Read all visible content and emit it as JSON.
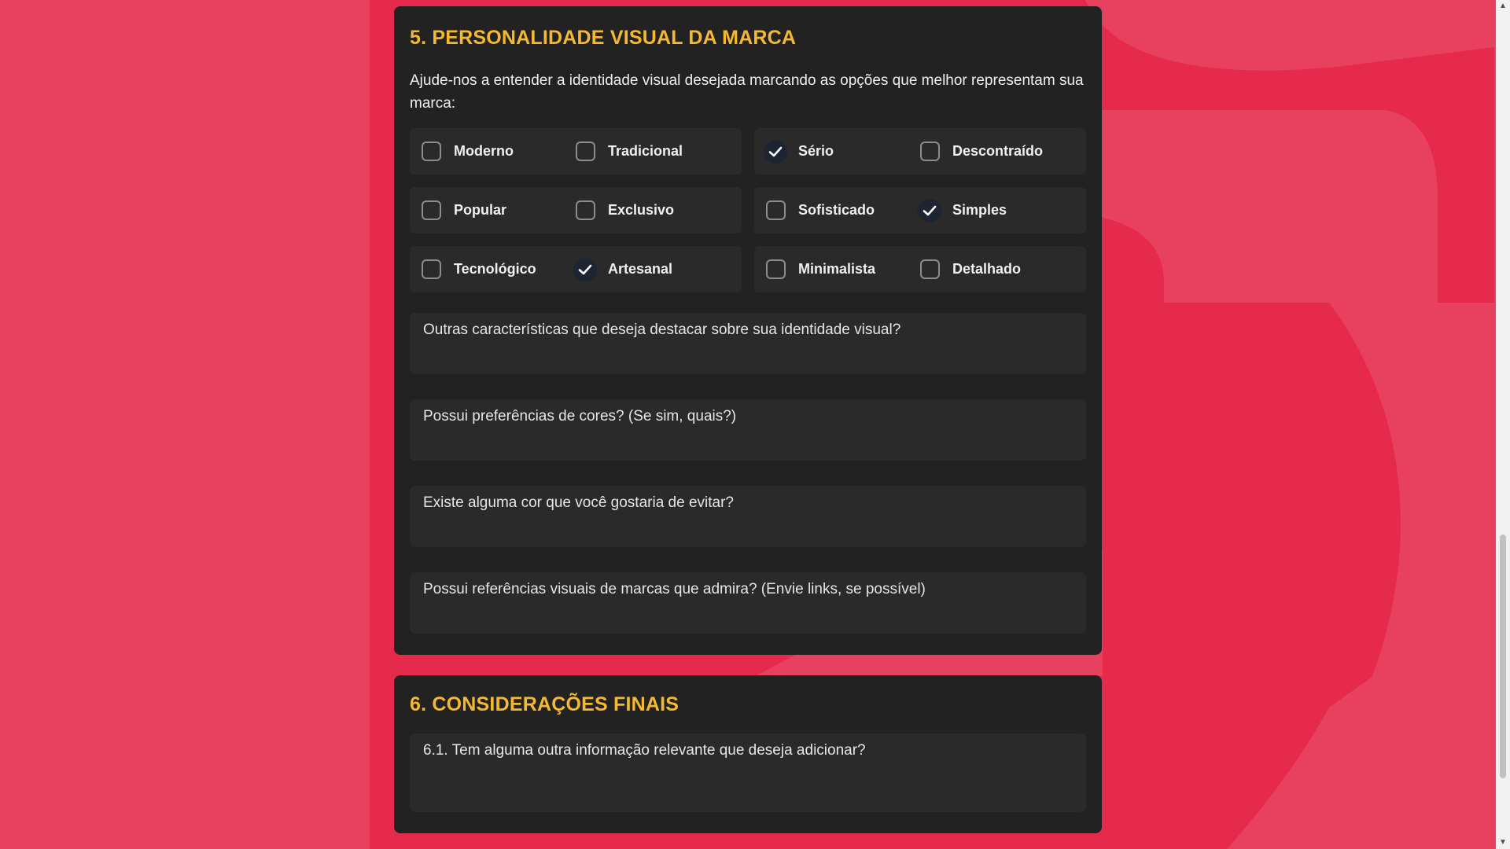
{
  "colors": {
    "background": "#e8405f",
    "panel": "#222222",
    "field": "#2a2a2a",
    "title": "#f5b82e",
    "checked_box": "#1f2433"
  },
  "section5": {
    "title": "5. PERSONALIDADE VISUAL DA MARCA",
    "intro": "Ajude-nos a entender a identidade visual desejada marcando as opções que melhor representam sua marca:",
    "options": [
      {
        "label": "Moderno",
        "checked": false,
        "icon": "checkbox-icon"
      },
      {
        "label": "Tradicional",
        "checked": false,
        "icon": "checkbox-icon"
      },
      {
        "label": "Sério",
        "checked": true,
        "icon": "check-icon"
      },
      {
        "label": "Descontraído",
        "checked": false,
        "icon": "checkbox-icon"
      },
      {
        "label": "Popular",
        "checked": false,
        "icon": "checkbox-icon"
      },
      {
        "label": "Exclusivo",
        "checked": false,
        "icon": "checkbox-icon"
      },
      {
        "label": "Sofisticado",
        "checked": false,
        "icon": "checkbox-icon"
      },
      {
        "label": "Simples",
        "checked": true,
        "icon": "check-icon"
      },
      {
        "label": "Tecnológico",
        "checked": false,
        "icon": "checkbox-icon"
      },
      {
        "label": "Artesanal",
        "checked": true,
        "icon": "check-icon"
      },
      {
        "label": "Minimalista",
        "checked": false,
        "icon": "checkbox-icon"
      },
      {
        "label": "Detalhado",
        "checked": false,
        "icon": "checkbox-icon"
      }
    ],
    "fields": {
      "other_traits": {
        "placeholder": "Outras características que deseja destacar sobre sua identidade visual?",
        "value": ""
      },
      "color_prefs": {
        "placeholder": "Possui preferências de cores? (Se sim, quais?)",
        "value": ""
      },
      "avoid_colors": {
        "placeholder": "Existe alguma cor que você gostaria de evitar?",
        "value": ""
      },
      "references": {
        "placeholder": "Possui referências visuais de marcas que admira? (Envie links, se possível)",
        "value": ""
      }
    }
  },
  "section6": {
    "title": "6. CONSIDERAÇÕES FINAIS",
    "fields": {
      "extra_info": {
        "placeholder": "6.1. Tem alguma outra informação relevante que deseja adicionar?",
        "value": ""
      }
    }
  }
}
